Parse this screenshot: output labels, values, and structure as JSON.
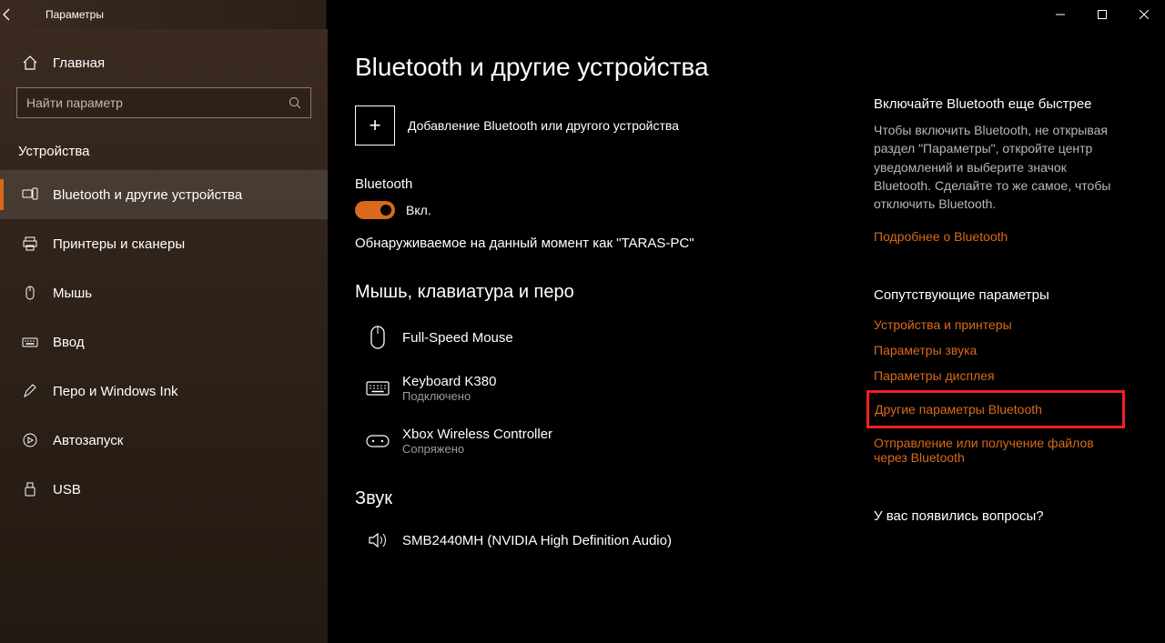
{
  "titlebar": {
    "title": "Параметры"
  },
  "sidebar": {
    "home": "Главная",
    "search_placeholder": "Найти параметр",
    "section": "Устройства",
    "items": [
      {
        "label": "Bluetooth и другие устройства"
      },
      {
        "label": "Принтеры и сканеры"
      },
      {
        "label": "Мышь"
      },
      {
        "label": "Ввод"
      },
      {
        "label": "Перо и Windows Ink"
      },
      {
        "label": "Автозапуск"
      },
      {
        "label": "USB"
      }
    ]
  },
  "content": {
    "heading": "Bluetooth и другие устройства",
    "add_device": "Добавление Bluetooth или другого устройства",
    "bt_label": "Bluetooth",
    "bt_state": "Вкл.",
    "discoverable": "Обнаруживаемое на данный момент как \"TARAS-PC\"",
    "cat_mouse": "Мышь, клавиатура и перо",
    "devices": [
      {
        "name": "Full-Speed Mouse",
        "status": ""
      },
      {
        "name": "Keyboard K380",
        "status": "Подключено"
      },
      {
        "name": "Xbox Wireless Controller",
        "status": "Сопряжено"
      }
    ],
    "cat_audio": "Звук",
    "audio_device": "SMB2440MH (NVIDIA High Definition Audio)"
  },
  "aside": {
    "tip_title": "Включайте Bluetooth еще быстрее",
    "tip_body": "Чтобы включить Bluetooth, не открывая раздел \"Параметры\", откройте центр уведомлений и выберите значок Bluetooth. Сделайте то же самое, чтобы отключить Bluetooth.",
    "more_bt": "Подробнее о Bluetooth",
    "related_title": "Сопутствующие параметры",
    "links": [
      "Устройства и принтеры",
      "Параметры звука",
      "Параметры дисплея",
      "Другие параметры Bluetooth",
      "Отправление или получение файлов через Bluetooth"
    ],
    "questions": "У вас появились вопросы?"
  }
}
